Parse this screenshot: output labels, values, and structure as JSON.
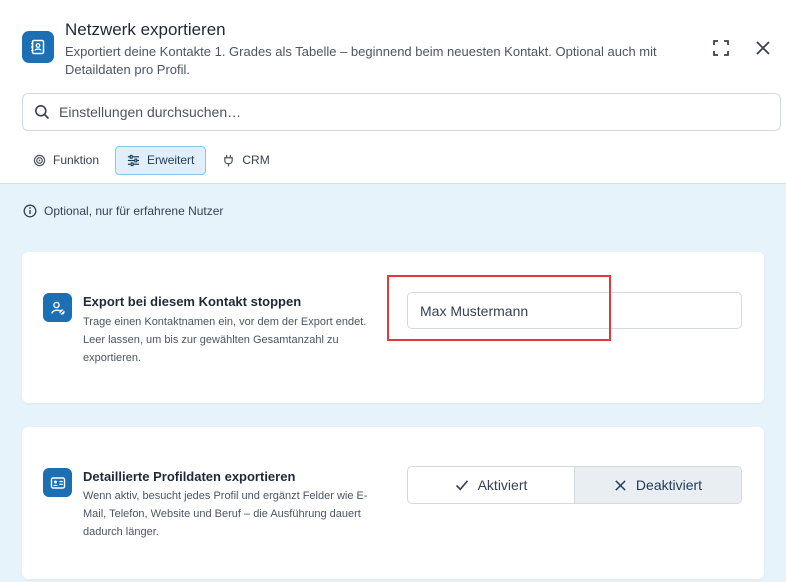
{
  "header": {
    "title": "Netzwerk exportieren",
    "subtitle": "Exportiert deine Kontakte 1. Grades als Tabelle – beginnend beim neuesten Kontakt. Optional auch mit Detaildaten pro Profil.",
    "app_icon": "contacts-book-icon",
    "expand_icon": "expand-icon",
    "close_icon": "close-icon"
  },
  "search": {
    "placeholder": "Einstellungen durchsuchen…"
  },
  "tabs": [
    {
      "label": "Funktion",
      "icon": "target-icon",
      "active": false
    },
    {
      "label": "Erweitert",
      "icon": "sliders-icon",
      "active": true
    },
    {
      "label": "CRM",
      "icon": "plug-icon",
      "active": false
    }
  ],
  "hint": {
    "text": "Optional, nur für erfahrene Nutzer",
    "icon": "info-icon"
  },
  "settings": [
    {
      "title": "Export bei diesem Kontakt stoppen",
      "description": "Trage einen Kontaktnamen ein, vor dem der Export endet. Leer lassen, um bis zur gewählten Gesamtanzahl zu exportieren.",
      "icon": "user-stop-icon",
      "value": "Max Mustermann"
    },
    {
      "title": "Detaillierte Profildaten exportieren",
      "description": "Wenn aktiv, besucht jedes Profil und ergänzt Felder wie E-Mail, Telefon, Website und Beruf – die Ausführung dauert dadurch länger.",
      "icon": "id-card-icon",
      "options": [
        "Aktiviert",
        "Deaktiviert"
      ],
      "selected": "Deaktiviert"
    }
  ],
  "colors": {
    "accent": "#1c6fb3",
    "content_bg": "#e6f3fb",
    "highlight": "#e03a3a"
  }
}
